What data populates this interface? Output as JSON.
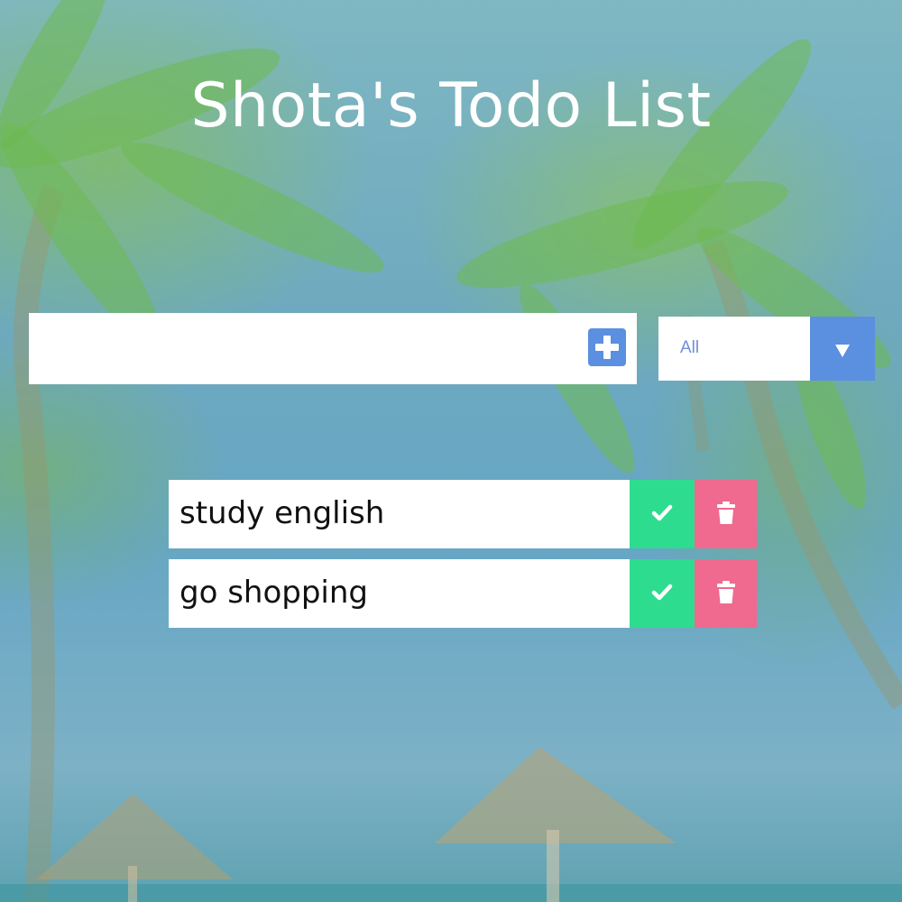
{
  "header": {
    "title": "Shota's Todo List"
  },
  "add_form": {
    "input_value": "",
    "add_icon": "plus-square-icon"
  },
  "filter": {
    "selected": "All",
    "arrow_icon": "caret-down-icon"
  },
  "todos": [
    {
      "text": "study english",
      "complete_icon": "check-icon",
      "delete_icon": "trash-icon"
    },
    {
      "text": "go shopping",
      "complete_icon": "check-icon",
      "delete_icon": "trash-icon"
    }
  ],
  "colors": {
    "accent_blue": "#5b8fe0",
    "complete_green": "#2edc8f",
    "delete_pink": "#ef6a8e",
    "title_text": "#ffffff"
  }
}
